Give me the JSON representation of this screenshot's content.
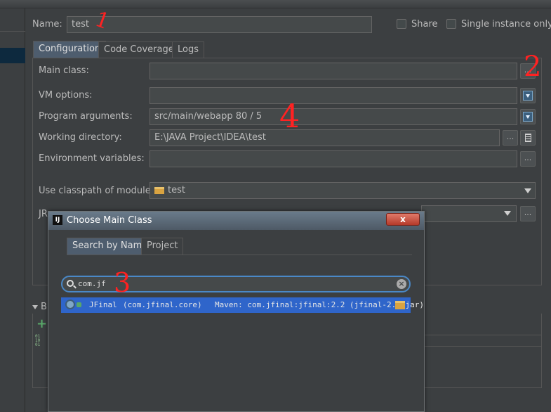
{
  "header": {
    "name_label": "Name:",
    "name_value": "test",
    "share_label": "Share",
    "single_instance_label": "Single instance only"
  },
  "tabs": [
    "Configuration",
    "Code Coverage",
    "Logs"
  ],
  "form": {
    "main_class_label": "Main class:",
    "main_class_value": "",
    "vm_options_label": "VM options:",
    "program_arguments_label": "Program arguments:",
    "program_arguments_value": "src/main/webapp 80 / 5",
    "working_directory_label": "Working directory:",
    "working_directory_value": "E:\\JAVA Project\\IDEA\\test",
    "environment_variables_label": "Environment variables:",
    "classpath_label": "Use classpath of module:",
    "classpath_value": "test",
    "jre_label_partial": "JR",
    "ellipsis": "...",
    "before_launch_partial": "B"
  },
  "dialog": {
    "title": "Choose Main Class",
    "close_label": "x",
    "tabs": [
      "Search by Name",
      "Project"
    ],
    "search_value": "com.jf",
    "result": {
      "class_name": "JFinal",
      "package": "(com.jfinal.core)",
      "source": "Maven: com.jfinal:jfinal:2.2 (jfinal-2.2.jar)"
    }
  },
  "annotations": [
    "1",
    "2",
    "3",
    "4"
  ],
  "colors": {
    "background": "#3c3f41",
    "field": "#45494a",
    "selection": "#2f65ca",
    "annotation": "#ff2222",
    "close_button": "#c94a3a"
  },
  "icons": [
    "folder-icon",
    "download-icon",
    "notepad-icon",
    "search-icon",
    "clear-icon",
    "class-icon",
    "jar-icon",
    "add-icon",
    "intellij-logo-icon"
  ]
}
